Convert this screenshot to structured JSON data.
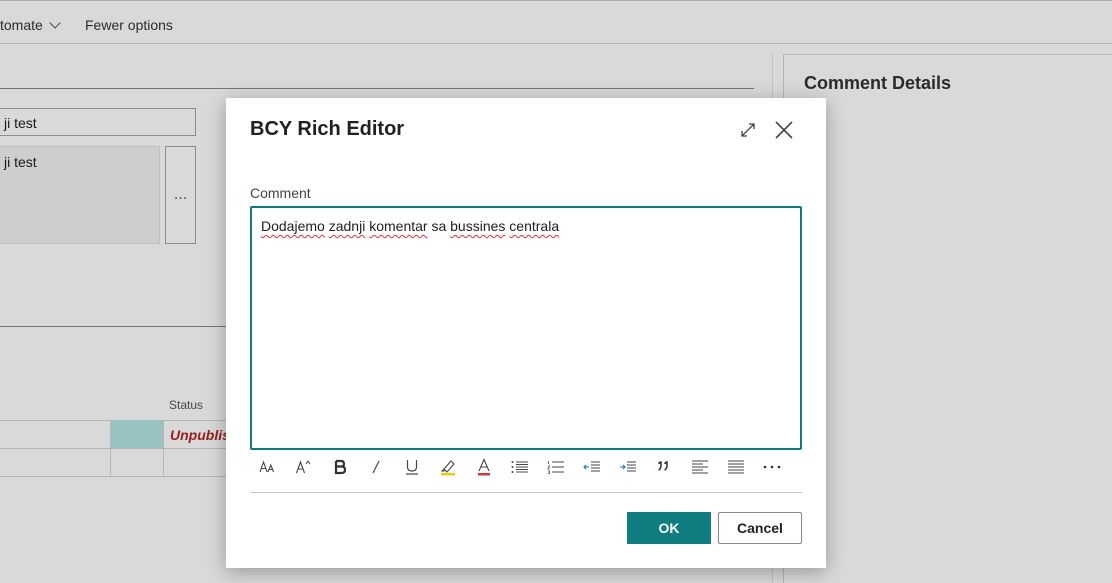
{
  "background": {
    "actionbar": {
      "automate_label": "tomate",
      "fewer_options_label": "Fewer options"
    },
    "field_input_value": "ji test",
    "field_area_value": "ji test",
    "assist_button_label": "...",
    "grid": {
      "status_header": "Status",
      "status_value": "Unpublis"
    },
    "factbox_title": "Comment Details"
  },
  "dialog": {
    "title": "BCY Rich Editor",
    "comment_label": "Comment",
    "comment_words": [
      "Dodajemo",
      "zadnji",
      "komentar",
      "sa",
      "bussines",
      "centrala"
    ],
    "toolbar_icons": [
      "font-size-icon",
      "superscript-font-icon",
      "bold-icon",
      "italic-icon",
      "underline-icon",
      "highlight-icon",
      "font-color-icon",
      "bullet-list-icon",
      "numbered-list-icon",
      "decrease-indent-icon",
      "increase-indent-icon",
      "quote-icon",
      "align-left-icon",
      "align-justify-icon",
      "more-options-icon"
    ],
    "ok_label": "OK",
    "cancel_label": "Cancel"
  },
  "colors": {
    "accent": "#0f7c7f",
    "status_red": "#b3262b",
    "selected_cell": "#b3e5e6",
    "highlight_yellow": "#f2c811",
    "font_color_red": "#d13438"
  }
}
